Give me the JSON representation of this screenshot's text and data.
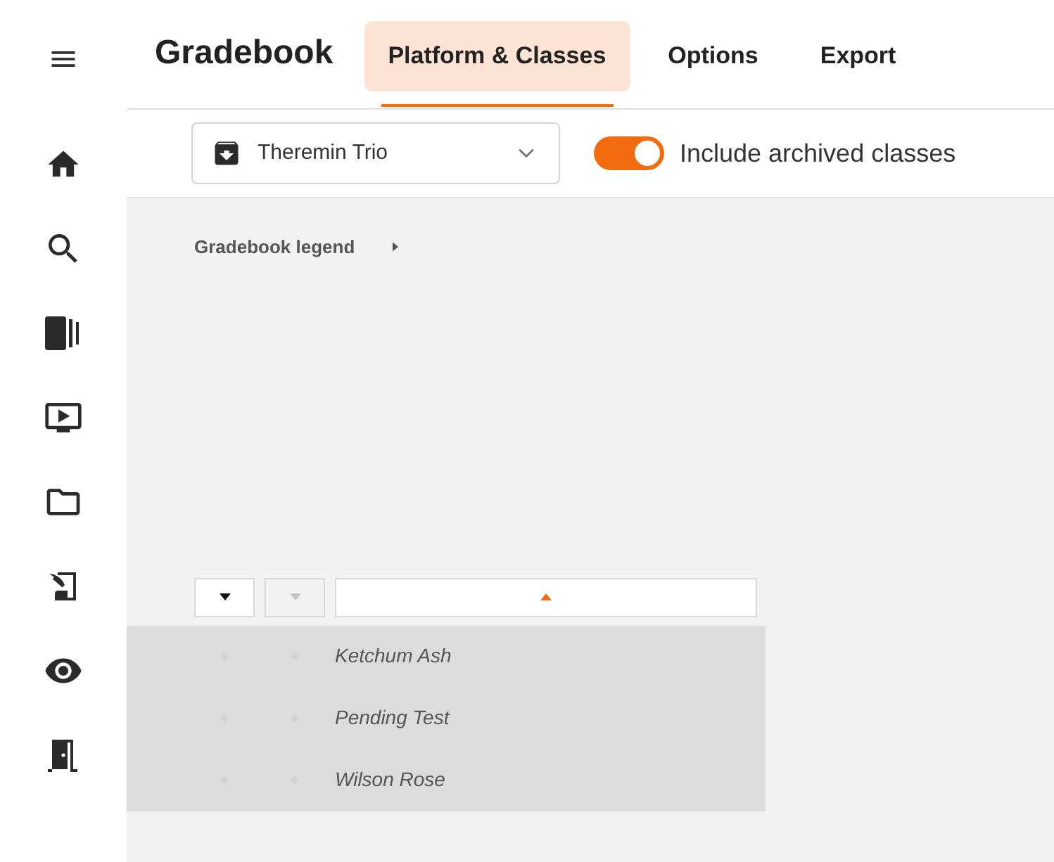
{
  "header": {
    "title": "Gradebook",
    "tabs": [
      {
        "label": "Platform & Classes",
        "selected": true
      },
      {
        "label": "Options",
        "selected": false
      },
      {
        "label": "Export",
        "selected": false
      }
    ]
  },
  "toolbar": {
    "class_select": {
      "value": "Theremin Trio"
    },
    "archived_toggle": {
      "label": "Include archived classes",
      "on": true
    }
  },
  "legend": {
    "label": "Gradebook legend",
    "expanded": false
  },
  "filters": [
    {
      "kind": "dropdown",
      "disabled": false
    },
    {
      "kind": "dropdown",
      "disabled": true
    },
    {
      "kind": "sort",
      "ascending": true
    }
  ],
  "rows": [
    {
      "name": "Ketchum Ash"
    },
    {
      "name": "Pending Test"
    },
    {
      "name": "Wilson Rose"
    }
  ]
}
